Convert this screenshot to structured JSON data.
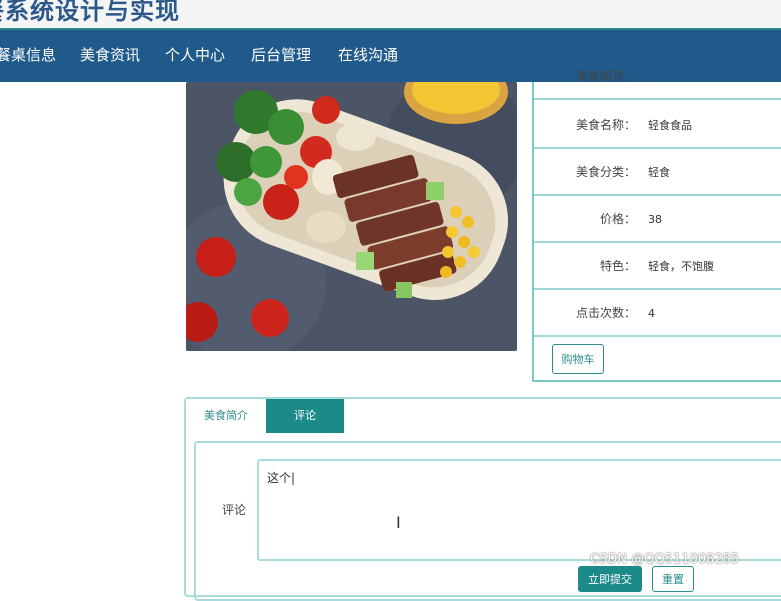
{
  "header": {
    "site_title": "餐系统设计与实现"
  },
  "nav": {
    "items": [
      {
        "label": "餐桌信息"
      },
      {
        "label": "美食资讯"
      },
      {
        "label": "个人中心"
      },
      {
        "label": "后台管理"
      },
      {
        "label": "在线沟通"
      }
    ]
  },
  "detail": {
    "rows": [
      {
        "label": "美食编号：",
        "value": ""
      },
      {
        "label": "美食名称：",
        "value": "轻食食品"
      },
      {
        "label": "美食分类：",
        "value": "轻食"
      },
      {
        "label": "价格：",
        "value": "38"
      },
      {
        "label": "特色：",
        "value": "轻食，不饱腹"
      },
      {
        "label": "点击次数：",
        "value": "4"
      }
    ],
    "cart_button": "购物车"
  },
  "tabs": [
    {
      "label": "美食简介"
    },
    {
      "label": "评论"
    }
  ],
  "comment": {
    "label": "评论",
    "value": "这个|",
    "submit": "立即提交",
    "reset": "重置"
  },
  "watermark": "CSDN @QQ511008285",
  "colors": {
    "nav_bg": "#1f5a8a",
    "accent": "#1d8a8a",
    "border": "#a8dcdc"
  }
}
